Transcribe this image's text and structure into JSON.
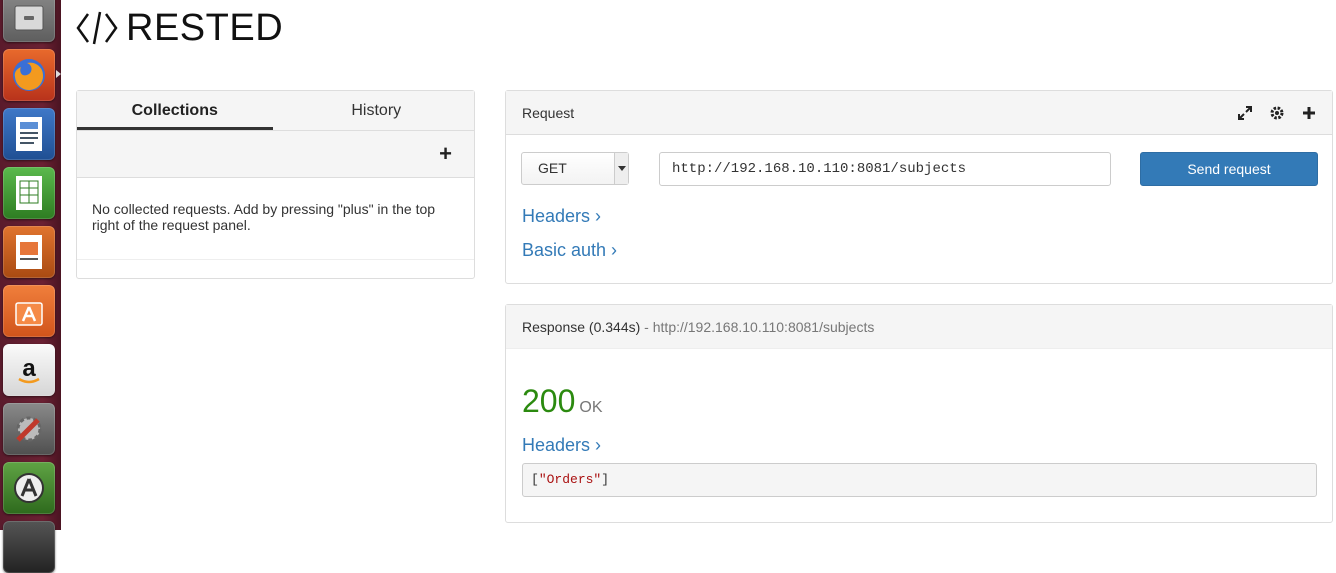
{
  "launcher": {
    "items": [
      {
        "name": "files",
        "icon": "file-cabinet-icon"
      },
      {
        "name": "firefox",
        "icon": "firefox-icon"
      },
      {
        "name": "writer",
        "icon": "libreoffice-writer-icon"
      },
      {
        "name": "calc",
        "icon": "libreoffice-calc-icon"
      },
      {
        "name": "impress",
        "icon": "libreoffice-impress-icon"
      },
      {
        "name": "software-center",
        "icon": "shopping-bag-icon"
      },
      {
        "name": "amazon",
        "icon": "amazon-icon"
      },
      {
        "name": "settings",
        "icon": "wrench-settings-icon"
      },
      {
        "name": "updater",
        "icon": "software-updater-icon"
      }
    ]
  },
  "app": {
    "title": "RESTED",
    "icon": "code-brackets-icon"
  },
  "sidebar": {
    "tabs": [
      {
        "label": "Collections",
        "active": true
      },
      {
        "label": "History",
        "active": false
      }
    ],
    "add_label": "+",
    "empty_message": "No collected requests. Add by pressing \"plus\" in the top right of the request panel."
  },
  "request": {
    "title": "Request",
    "icons": [
      "expand-icon",
      "gear-icon",
      "plus-icon"
    ],
    "method": "GET",
    "url": "http://192.168.10.110:8081/subjects",
    "send_label": "Send request",
    "headers_link": "Headers ›",
    "basic_auth_link": "Basic auth ›"
  },
  "response": {
    "title": "Response (0.344s)",
    "separator": " - ",
    "url": "http://192.168.10.110:8081/subjects",
    "status_code": "200",
    "status_text": "OK",
    "headers_link": "Headers ›",
    "body_open": "[",
    "body_string": "\"Orders\"",
    "body_close": "]"
  },
  "colors": {
    "accent": "#337ab7",
    "success": "#2b8a0f",
    "launcher_bg": "#6b2133"
  }
}
